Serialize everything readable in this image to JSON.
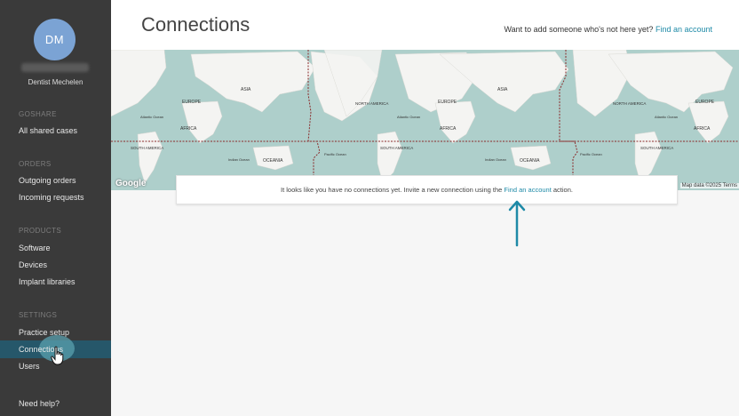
{
  "sidebar": {
    "avatar_initials": "DM",
    "user_name": "Dentist Mechelen",
    "sections": {
      "goshare": "GOSHARE",
      "orders": "ORDERS",
      "products": "PRODUCTS",
      "settings": "SETTINGS"
    },
    "items": {
      "all_shared_cases": "All shared cases",
      "outgoing_orders": "Outgoing orders",
      "incoming_requests": "Incoming requests",
      "software": "Software",
      "devices": "Devices",
      "implant_libraries": "Implant libraries",
      "practice_setup": "Practice setup",
      "connections": "Connections",
      "users": "Users"
    },
    "help": "Need help?"
  },
  "header": {
    "title": "Connections",
    "prompt": "Want to add someone who's not here yet?",
    "link": "Find an account"
  },
  "map": {
    "labels": {
      "asia": "ASIA",
      "europe": "EUROPE",
      "africa": "AFRICA",
      "north_america": "NORTH AMERICA",
      "south_america": "SOUTH AMERICA",
      "oceania": "OCEANIA",
      "atlantic": "Atlantic Ocean",
      "indian": "Indian Ocean",
      "pacific": "Pacific Ocean"
    },
    "google": "Google",
    "attribution": "Map data ©2025  Terms"
  },
  "notice": {
    "text_before": "It looks like you have no connections yet. Invite a new connection using the ",
    "link": "Find an account",
    "text_after": " action."
  },
  "colors": {
    "sidebar_bg": "#3a3a3a",
    "active_item": "#26576a",
    "accent": "#1e8aa7",
    "map_water": "#aecfcb"
  }
}
